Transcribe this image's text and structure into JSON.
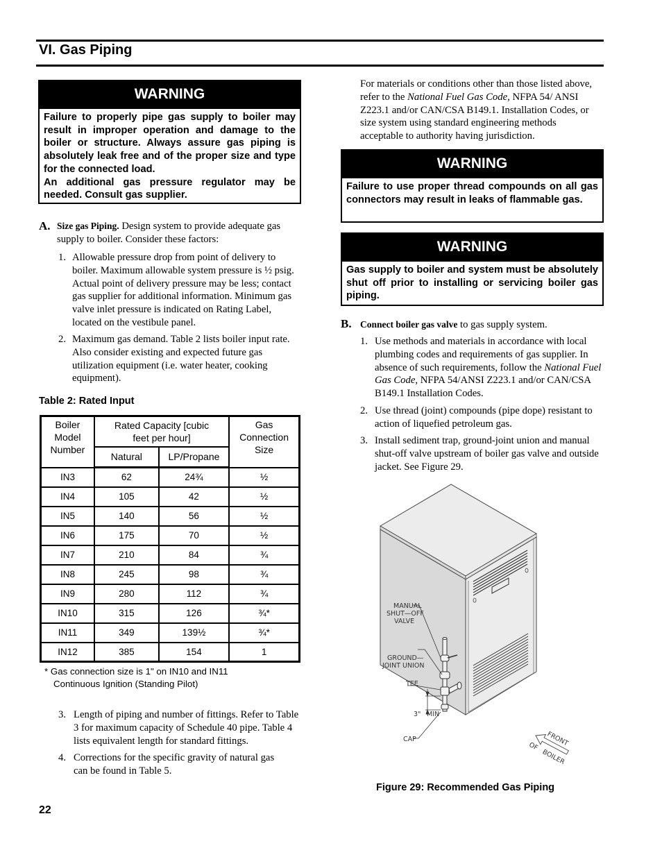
{
  "section": {
    "title": "VI.  Gas Piping",
    "page_number": "22"
  },
  "warnings": [
    {
      "heading": "WARNING",
      "paragraphs": [
        "Failure to properly pipe gas supply to boiler may result in improper operation and damage to the boiler or structure.  Always assure gas piping is absolutely leak free and of the proper size and type for the connected load.",
        "An additional gas pressure regulator may be needed.  Consult gas supplier."
      ]
    },
    {
      "heading": "WARNING",
      "paragraphs": [
        "Failure to use proper thread compounds on all gas connectors may result in leaks of flammable gas."
      ]
    },
    {
      "heading": "WARNING",
      "paragraphs": [
        "Gas supply to boiler and system must be absolutely shut off prior to installing or servicing boiler gas piping."
      ]
    }
  ],
  "step_a": {
    "letter": "A.",
    "lead": "Size gas Piping.",
    "text": " Design system to provide adequate gas supply to boiler. Consider these factors:",
    "items": [
      {
        "num": "1.",
        "text": "Allowable pressure drop from point of delivery to boiler. Maximum allowable system pressure is ½ psig. Actual point of delivery pressure may be less; contact gas supplier for additional information. Minimum gas valve inlet pressure is indicated on Rating Label, located on the vestibule panel."
      },
      {
        "num": "2.",
        "text": "Maximum gas demand. Table 2 lists boiler input rate. Also consider existing and expected future gas utilization equipment (i.e. water heater, cooking equipment)."
      },
      {
        "num": "3.",
        "text": "Length of piping and number of fittings. Refer to Table 3 for maximum capacity of Schedule 40 pipe. Table 4 lists equivalent length for standard fittings."
      },
      {
        "num": "4.",
        "text": "Corrections for the specific gravity of natural gas can be found in Table 5."
      }
    ]
  },
  "table2": {
    "title": "Table 2: Rated Input",
    "headers": {
      "model": "Boiler Model Number",
      "capacity": "Rated Capacity [cubic feet per hour]",
      "natural": "Natural",
      "lp": "LP/Propane",
      "connection": "Gas Connection Size"
    },
    "rows": [
      {
        "model": "IN3",
        "natural": "62",
        "lp": "24¾",
        "size": "½"
      },
      {
        "model": "IN4",
        "natural": "105",
        "lp": "42",
        "size": "½"
      },
      {
        "model": "IN5",
        "natural": "140",
        "lp": "56",
        "size": "½"
      },
      {
        "model": "IN6",
        "natural": "175",
        "lp": "70",
        "size": "½"
      },
      {
        "model": "IN7",
        "natural": "210",
        "lp": "84",
        "size": "¾"
      },
      {
        "model": "IN8",
        "natural": "245",
        "lp": "98",
        "size": "¾"
      },
      {
        "model": "IN9",
        "natural": "280",
        "lp": "112",
        "size": "¾"
      },
      {
        "model": "IN10",
        "natural": "315",
        "lp": "126",
        "size": "¾*"
      },
      {
        "model": "IN11",
        "natural": "349",
        "lp": "139½",
        "size": "¾*"
      },
      {
        "model": "IN12",
        "natural": "385",
        "lp": "154",
        "size": "1"
      }
    ],
    "footnote_line1": "*  Gas connection size is 1\" on IN10 and IN11",
    "footnote_line2": "Continuous Ignition (Standing Pilot)"
  },
  "right_intro": {
    "before_italic": "For materials or conditions other than those listed above, refer to the ",
    "italic": "National Fuel Gas Code",
    "after_italic": ", NFPA 54/ ANSI Z223.1 and/or CAN/CSA B149.1. Installation Codes, or size system using standard engineering methods acceptable to authority having jurisdiction."
  },
  "step_b": {
    "letter": "B.",
    "lead": "Connect boiler gas valve",
    "text": " to gas supply system.",
    "item1": {
      "num": "1.",
      "before_italic": "Use methods and materials in accordance with local plumbing codes and requirements of gas supplier. In absence of such requirements, follow the ",
      "italic": "National Fuel Gas Code",
      "after_italic": ", NFPA 54/ANSI Z223.1 and/or CAN/CSA B149.1 Installation Codes."
    },
    "item2": {
      "num": "2.",
      "text": "Use thread (joint) compounds (pipe dope) resistant to action of liquefied petroleum gas."
    },
    "item3": {
      "num": "3.",
      "text": "Install sediment trap, ground-joint union and manual shut-off valve upstream of boiler gas valve and outside jacket. See Figure 29."
    }
  },
  "figure": {
    "caption": "Figure 29: Recommended Gas Piping",
    "labels": {
      "valve_1": "MANUAL",
      "valve_2": "SHUT—OFF",
      "valve_3": "VALVE",
      "union_1": "GROUND—",
      "union_2": "JOINT  UNION",
      "tee": "TEE",
      "min_1": "3\"",
      "min_2": "MIN",
      "cap": "CAP",
      "front_1": "FRONT",
      "front_2": "OF",
      "front_3": "BOILER"
    }
  }
}
